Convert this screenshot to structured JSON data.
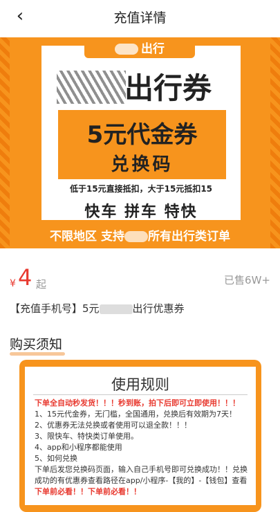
{
  "nav": {
    "back_icon": "chevron-left-icon",
    "title": "充值详情"
  },
  "banner": {
    "tag_text": "出行",
    "big_title": "出行券",
    "coupon_line": "5元代金券",
    "code_line": "兑换码",
    "rule_line": "低于15元直接抵扣，大于15元抵扣15",
    "categories": "快车  拼车  特快",
    "footer_left": "不限地区  支持",
    "footer_right": "所有出行类订单",
    "accent_color": "#f7941d"
  },
  "price": {
    "currency": "¥",
    "value": "4",
    "suffix": "起",
    "sold": "已售6W+"
  },
  "product": {
    "name_prefix": "【充值手机号】5元",
    "name_suffix": "出行优惠券"
  },
  "section": {
    "title": "购买须知"
  },
  "rules": {
    "title": "使用规则",
    "lines": [
      "下单全自动秒发货！！！秒到账，拍下后即可立即使用！！！",
      "1、15元代金券，无门槛，全国通用，兑换后有效期为7天！",
      "2、优惠券无法兑换或者使用可以退全款！！！",
      "3、限快车、特快类订单使用。",
      "4、app和小程序都能使用",
      "5、如何兑换",
      "下单后发您兑换码页面，输入自己手机号即可兑换成功！！兑换成功的有优惠券查看路径在app/小程序-【我的】-【钱包】查看",
      "下单前必看！！下单前必看！！"
    ]
  }
}
